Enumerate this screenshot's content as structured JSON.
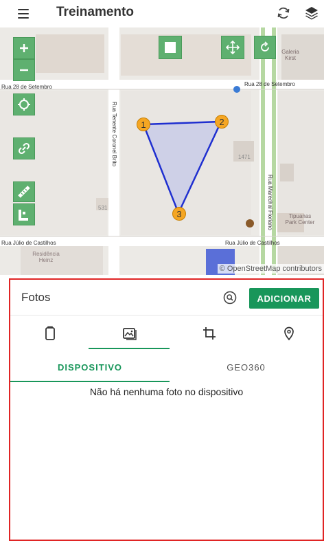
{
  "app_bar": {
    "title": "Treinamento",
    "icons": [
      "menu-icon",
      "sync-icon",
      "layers-icon"
    ]
  },
  "map": {
    "attribution": "© OpenStreetMap contributors",
    "streets": {
      "rua_28_left": "Rua 28 de Setembro",
      "rua_28_right": "Rua 28 de Setembro",
      "rua_tenente": "Rua Tenente Coronel Brito",
      "rua_marechal": "Rua Marechal Floriano",
      "rua_julio_left": "Rua Júlio de Castilhos",
      "rua_julio_right": "Rua Júlio de Castilhos"
    },
    "places": {
      "residencia": "Residência Heinz",
      "tipuanas": "Tipuanas Park Center",
      "galeria": "Galeria Kirst",
      "number_1": "1471",
      "number_2": "531"
    },
    "vertices": [
      "1",
      "2",
      "3"
    ],
    "colors": {
      "button": "#5fb070",
      "polygon_stroke": "#1f2fd0",
      "polygon_fill": "#c9cbe8",
      "vertex": "#f5a623"
    }
  },
  "photos_panel": {
    "title": "Fotos",
    "add_button": "ADICIONAR",
    "icon_tabs": [
      "clipboard-icon",
      "image-icon",
      "crop-icon",
      "location-icon"
    ],
    "active_icon_tab": 1,
    "tabs": [
      "DISPOSITIVO",
      "GEO360"
    ],
    "active_tab": 0,
    "empty_message": "Não há nenhuma foto no dispositivo",
    "colors": {
      "accent": "#18965a",
      "highlight_border": "#e02424"
    }
  }
}
